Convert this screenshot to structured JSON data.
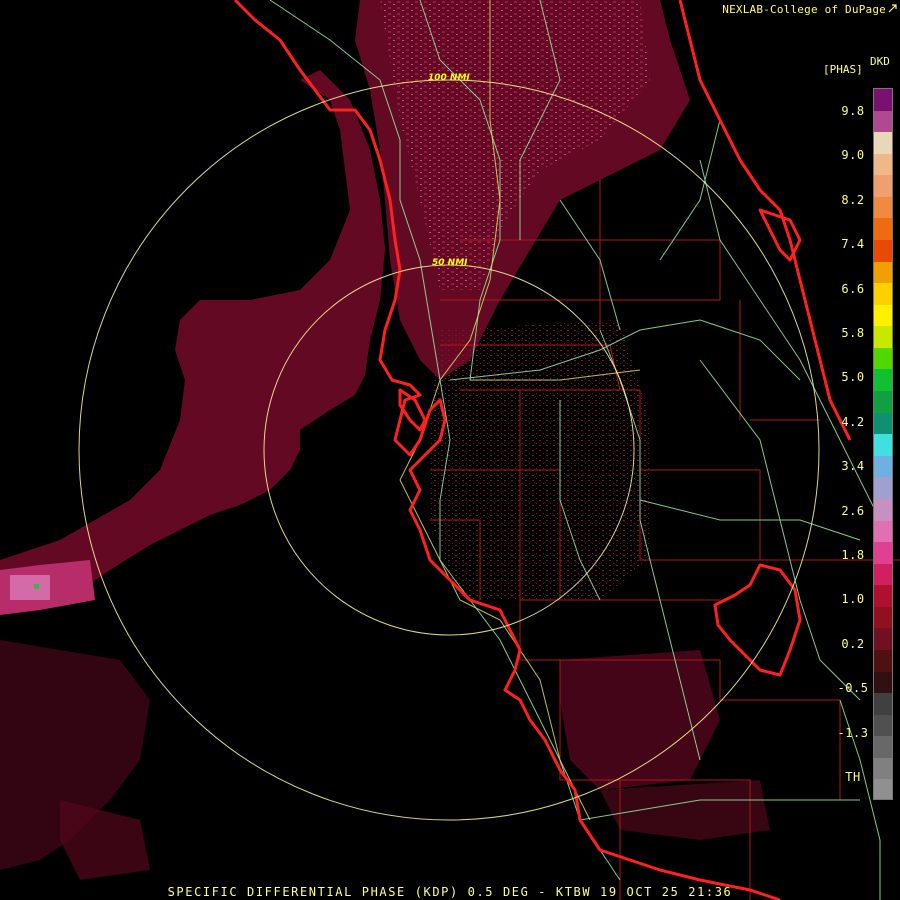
{
  "header": {
    "credit": "NEXLAB-College of DuPage",
    "credit_icon": "diagonal-arrow-icon"
  },
  "radar": {
    "product_code": "DKD",
    "unit": "[PHAS]",
    "ring_labels": [
      "100 NMI",
      "50 NMI"
    ],
    "caption": "SPECIFIC DIFFERENTIAL PHASE (KDP) 0.5 DEG - KTBW 19 OCT 25 21:36"
  },
  "legend": {
    "ticks": [
      "9.8",
      "9.0",
      "8.2",
      "7.4",
      "6.6",
      "5.8",
      "5.0",
      "4.2",
      "3.4",
      "2.6",
      "1.8",
      "1.0",
      "0.2",
      "-0.5",
      "-1.3",
      "TH"
    ],
    "colors": [
      "#7a1070",
      "#b04a90",
      "#e8d8b8",
      "#f0b888",
      "#f0a070",
      "#f08a40",
      "#f06a10",
      "#e84a00",
      "#f0a000",
      "#ffd000",
      "#fff000",
      "#c8e800",
      "#50d800",
      "#10c030",
      "#10a040",
      "#109070",
      "#40e0e0",
      "#70b0e0",
      "#a0a0d0",
      "#c890c0",
      "#e070b0",
      "#e04090",
      "#d02060",
      "#b01030",
      "#901020",
      "#701020",
      "#501010",
      "#301010",
      "#404040",
      "#505050",
      "#686868",
      "#808080",
      "#909090"
    ]
  },
  "colors": {
    "coast": "#ff2020",
    "county": "#b01818",
    "roads": "#90e0a0",
    "rings": "#ffff99",
    "echo": "#6a0a25"
  }
}
